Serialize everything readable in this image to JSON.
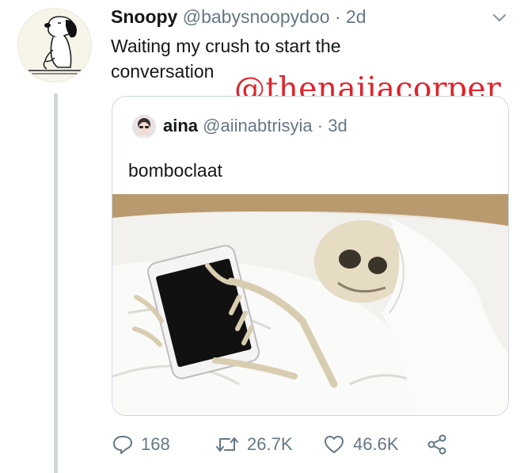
{
  "tweet": {
    "display_name": "Snoopy",
    "handle": "@babysnoopydoo",
    "separator": "·",
    "time": "2d",
    "text": "Waiting my crush to start the conversation"
  },
  "watermark": "@thenaijacorper",
  "quote": {
    "display_name": "aina",
    "handle": "@aiinabtrisyia",
    "separator": "·",
    "time": "3d",
    "text": "bomboclaat"
  },
  "actions": {
    "replies": "168",
    "retweets": "26.7K",
    "likes": "46.6K"
  },
  "icons": {
    "reply": "reply-icon",
    "retweet": "retweet-icon",
    "like": "heart-icon",
    "share": "share-icon",
    "menu": "chevron-down-icon"
  },
  "colors": {
    "secondary_text": "#657786",
    "thread_line": "#cfd6dc",
    "card_border": "#ccd6dd",
    "watermark": "#e0232b"
  }
}
